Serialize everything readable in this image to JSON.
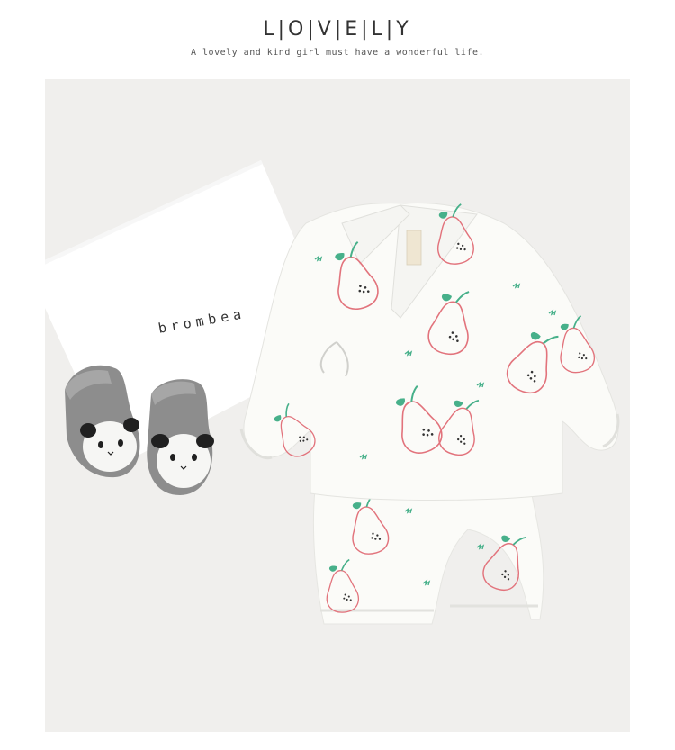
{
  "header": {
    "title": "L|O|V|E|L|Y",
    "tagline": "A lovely and kind girl must have a wonderful life."
  },
  "photo": {
    "card_label": "brombea",
    "colors": {
      "background": "#f0efed",
      "card": "#ffffff",
      "garment": "#fbfbf8",
      "pear_outline": "#e2737c",
      "leaf": "#47b08a",
      "sock_gray": "#8d8d8d",
      "panda_black": "#202020"
    },
    "icons": [
      "pear-print-icon",
      "panda-face-icon"
    ]
  }
}
